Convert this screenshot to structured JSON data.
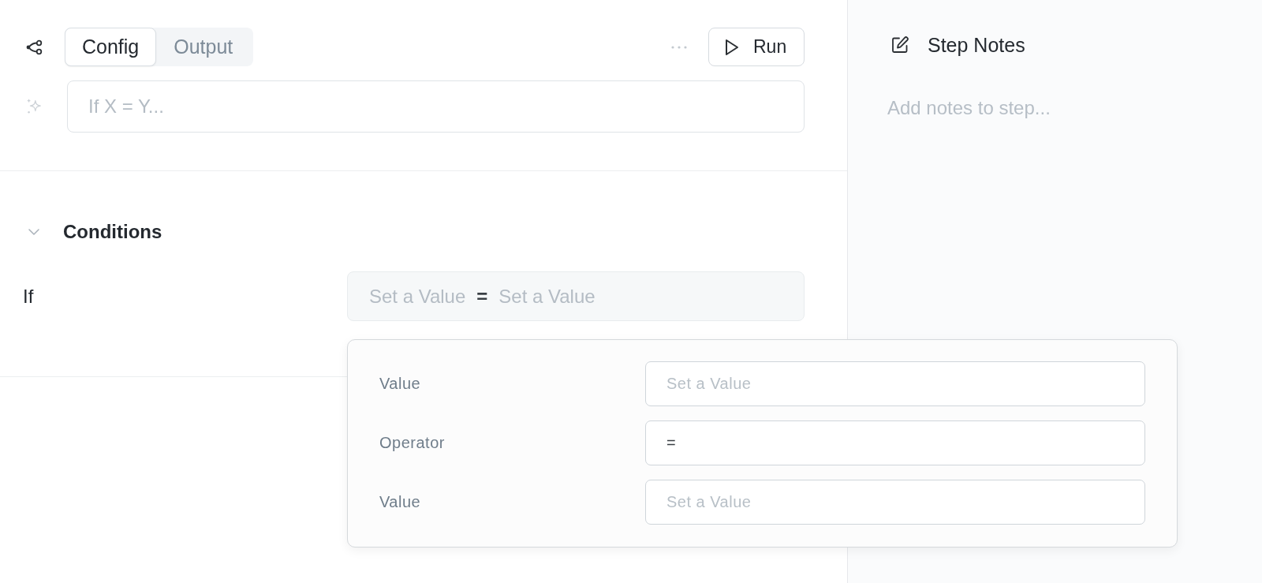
{
  "toolbar": {
    "tabs": [
      {
        "label": "Config",
        "selected": true
      },
      {
        "label": "Output",
        "selected": false
      }
    ],
    "run_button": "Run"
  },
  "prompt": {
    "placeholder": "If X = Y..."
  },
  "conditions": {
    "title": "Conditions",
    "expanded": true,
    "rows": [
      {
        "label": "If",
        "left": {
          "placeholder": "Set a Value"
        },
        "operator": "=",
        "right": {
          "placeholder": "Set a Value"
        }
      }
    ]
  },
  "popover": {
    "fields": [
      {
        "label": "Value",
        "placeholder": "Set a Value"
      },
      {
        "label": "Operator",
        "value": "="
      },
      {
        "label": "Value",
        "placeholder": "Set a Value"
      }
    ]
  },
  "notes": {
    "title": "Step Notes",
    "placeholder": "Add notes to step..."
  }
}
